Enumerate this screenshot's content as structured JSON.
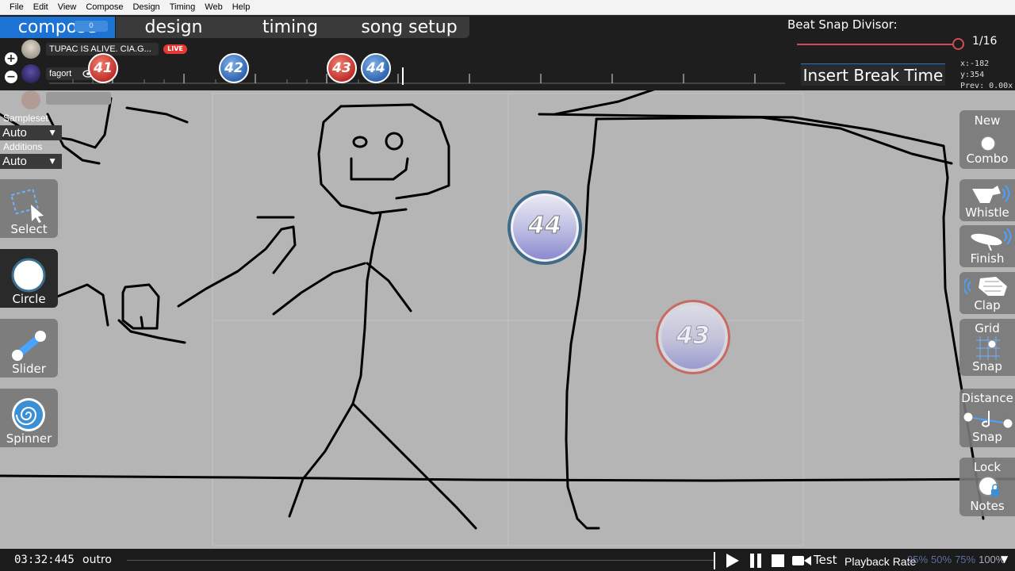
{
  "menu": [
    "File",
    "Edit",
    "View",
    "Compose",
    "Design",
    "Timing",
    "Web",
    "Help"
  ],
  "modes": {
    "compose": "compose",
    "compose_sub": "0",
    "design": "design",
    "timing": "timing",
    "song_setup": "song setup"
  },
  "users": [
    {
      "name": "TUPAC IS ALIVE. CIA.G...",
      "live": "LIVE"
    },
    {
      "name": "fagort"
    }
  ],
  "timeline_combos": [
    "41",
    "42",
    "43",
    "44"
  ],
  "beat_snap": {
    "label": "Beat Snap Divisor:",
    "value": "1/16",
    "level": 0.96
  },
  "coords": {
    "pos": "x:-182 y:354",
    "prev": "Prev: 0.00x"
  },
  "insert_break": "Insert Break Time",
  "left_panel": {
    "sampleset_label": "Sampleset",
    "sampleset_value": "Auto",
    "additions_label": "Additions",
    "additions_value": "Auto",
    "tools": [
      "Select",
      "Circle",
      "Slider",
      "Spinner"
    ]
  },
  "hit_objects": [
    {
      "number": "44",
      "ring": "#4a6f8a"
    },
    {
      "number": "43",
      "ring": "#c0605a"
    }
  ],
  "right_panel": {
    "new_combo": [
      "New",
      "Combo"
    ],
    "whistle": "Whistle",
    "finish": "Finish",
    "clap": "Clap",
    "grid_snap": [
      "Grid",
      "Snap"
    ],
    "distance_snap": [
      "Distance",
      "Snap"
    ],
    "lock_notes": [
      "Lock",
      "Notes"
    ]
  },
  "bottom": {
    "time": "03:32:445",
    "section": "outro",
    "test": "Test",
    "playback_label": "Playback Rate",
    "rates": [
      "25%",
      "50%",
      "75%",
      "100%"
    ]
  },
  "colors": {
    "accent": "#1c73d4",
    "snap": "#d24a56",
    "playfield": "#b5b5b5"
  }
}
